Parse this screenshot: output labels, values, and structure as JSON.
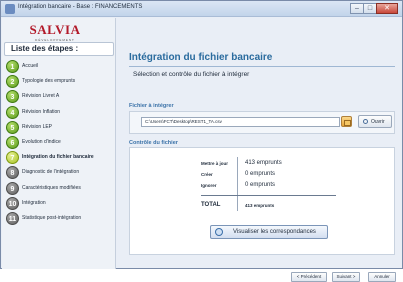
{
  "window": {
    "title": "Intégration bancaire - Base : FINANCEMENTS",
    "minimize": "–",
    "maximize": "□",
    "close": "✕"
  },
  "logo": {
    "text": "SALVIA",
    "sub": "DÉVELOPPEMENT"
  },
  "sidebar": {
    "header": "Liste des étapes :",
    "steps": [
      {
        "num": "1",
        "label": "Accueil",
        "state": "done"
      },
      {
        "num": "2",
        "label": "Typologie des emprunts",
        "state": "done"
      },
      {
        "num": "3",
        "label": "Révision Livret A",
        "state": "done"
      },
      {
        "num": "4",
        "label": "Révision Inflation",
        "state": "done"
      },
      {
        "num": "5",
        "label": "Révision LEP",
        "state": "done"
      },
      {
        "num": "6",
        "label": "Evolution d'indice",
        "state": "done"
      },
      {
        "num": "7",
        "label": "Intégration du fichier bancaire",
        "state": "current"
      },
      {
        "num": "8",
        "label": "Diagnostic de l'intégration",
        "state": "todo"
      },
      {
        "num": "9",
        "label": "Caractéristiques modifiées",
        "state": "todo"
      },
      {
        "num": "10",
        "label": "Intégration",
        "state": "todo"
      },
      {
        "num": "11",
        "label": "Statistique post-intégration",
        "state": "todo"
      }
    ]
  },
  "main": {
    "title": "Intégration du fichier bancaire",
    "subtitle": "Sélection et contrôle du fichier à intégrer",
    "file_section_label": "Fichier à intégrer",
    "file_path": "C:\\Users\\FCT\\Desktop\\REST1_TA.csv",
    "open_label": "Ouvrir",
    "control_section_label": "Contrôle du fichier",
    "rows": [
      {
        "label": "Mettre à jour",
        "value": "413 emprunts"
      },
      {
        "label": "Créer",
        "value": "0 emprunts"
      },
      {
        "label": "Ignorer",
        "value": "0 emprunts"
      }
    ],
    "total_label": "TOTAL",
    "total_value": "413 emprunts",
    "viz_label": "Visualiser les correspondances"
  },
  "nav": {
    "previous": "< Précédent",
    "next": "Suivant >",
    "cancel": "Annuler"
  }
}
